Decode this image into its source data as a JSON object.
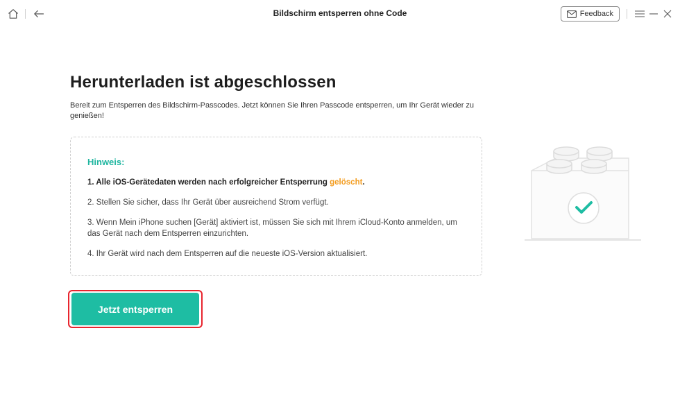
{
  "window": {
    "title": "Bildschirm entsperren ohne Code",
    "feedback_label": "Feedback"
  },
  "icons": {
    "home": "home-icon",
    "back": "arrow-left-icon",
    "mail": "mail-icon",
    "menu": "menu-icon",
    "minimize": "minimize-icon",
    "close": "close-icon",
    "success": "check-icon"
  },
  "main": {
    "heading": "Herunterladen ist abgeschlossen",
    "subtitle": "Bereit zum Entsperren des Bildschirm-Passcodes. Jetzt können Sie Ihren Passcode entsperren, um Ihr Gerät wieder zu genießen!",
    "note": {
      "title": "Hinweis:",
      "item1_prefix": "1. Alle iOS-Gerätedaten werden nach erfolgreicher Entsperrung ",
      "item1_highlight": "gelöscht",
      "item1_suffix": ".",
      "item2": "2. Stellen Sie sicher, dass Ihr Gerät über ausreichend Strom verfügt.",
      "item3": "3. Wenn Mein iPhone suchen [Gerät] aktiviert ist, müssen Sie sich mit Ihrem iCloud-Konto anmelden, um das Gerät nach dem Entsperren einzurichten.",
      "item4": "4. Ihr Gerät wird nach dem Entsperren auf die neueste iOS-Version aktualisiert."
    },
    "unlock_button": "Jetzt entsperren"
  },
  "colors": {
    "accent": "#1ebda3",
    "note_title": "#20b6a0",
    "warning": "#f39c1f",
    "highlight_outline": "#e8252e"
  }
}
